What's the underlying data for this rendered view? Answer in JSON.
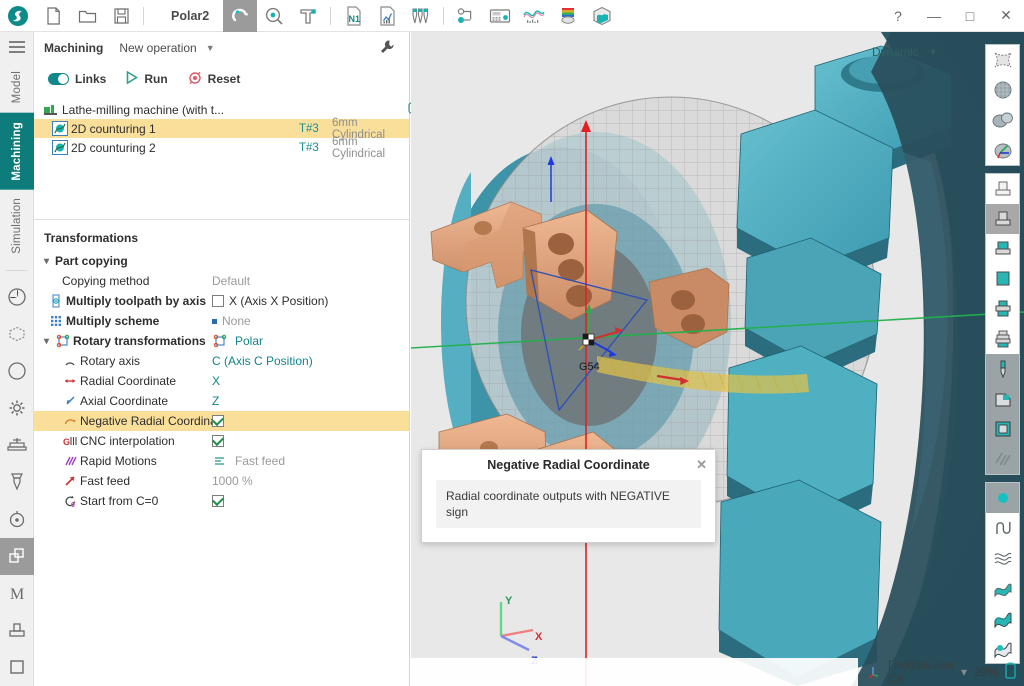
{
  "titlebar": {
    "document_title": "Polar2",
    "file_icons": [
      {
        "name": "new-file-icon",
        "label": "New"
      },
      {
        "name": "open-folder-icon",
        "label": "Open"
      },
      {
        "name": "save-icon",
        "label": "Save"
      }
    ],
    "mode_icons": [
      {
        "name": "machining-mode-icon",
        "label": "Machining",
        "active": true
      },
      {
        "name": "simulation-verify-icon",
        "label": "Verification"
      },
      {
        "name": "tool-setup-icon",
        "label": "Tool setup"
      },
      {
        "name": "nc-program-icon",
        "label": "N1"
      },
      {
        "name": "report-chart-icon",
        "label": "Report"
      },
      {
        "name": "tool-list-icon",
        "label": "Tool list"
      },
      {
        "name": "machine-scheme-icon",
        "label": "Machine scheme"
      },
      {
        "name": "cnc-panel-icon",
        "label": "CNC panel"
      },
      {
        "name": "graph-icon",
        "label": "Graph"
      },
      {
        "name": "material-icon",
        "label": "Material"
      },
      {
        "name": "stock-model-icon",
        "label": "Stock model"
      }
    ],
    "window_buttons": [
      {
        "name": "help-button",
        "glyph": "?"
      },
      {
        "name": "minimize-button",
        "glyph": "—"
      },
      {
        "name": "maximize-button",
        "glyph": "□"
      },
      {
        "name": "close-button",
        "glyph": "✕"
      }
    ]
  },
  "left_rail": {
    "menu_label": "menu",
    "tabs": [
      {
        "label": "Model",
        "selected": false
      },
      {
        "label": "Machining",
        "selected": true
      },
      {
        "label": "Simulation",
        "selected": false
      }
    ],
    "icons": [
      {
        "name": "render-shading-icon",
        "selected": false
      },
      {
        "name": "stock-selection-icon",
        "selected": false
      },
      {
        "name": "compass-orientation-icon",
        "selected": false
      },
      {
        "name": "settings-gear-icon",
        "selected": false
      },
      {
        "name": "machine-table-icon",
        "selected": false
      },
      {
        "name": "tool-holder-icon",
        "selected": false
      },
      {
        "name": "spindle-gauge-icon",
        "selected": false
      },
      {
        "name": "transformations-icon",
        "selected": true
      },
      {
        "name": "macro-m-icon",
        "selected": false
      },
      {
        "name": "fixture-icon",
        "selected": false
      },
      {
        "name": "blank-square-icon",
        "selected": false
      }
    ]
  },
  "operation_panel": {
    "title": "Machining",
    "new_operation_label": "New operation",
    "actions": [
      {
        "name": "links-toggle",
        "label": "Links",
        "on": true
      },
      {
        "name": "run-button",
        "label": "Run"
      },
      {
        "name": "reset-button",
        "label": "Reset"
      }
    ],
    "settings_icon": "wrench-icon"
  },
  "tree": {
    "rows": [
      {
        "name": "machine-node",
        "icon": "machine-icon",
        "label": "Lathe-milling machine (with t...",
        "tool": "",
        "description": "",
        "selected": false,
        "has_dot": false,
        "dot_color": "",
        "state_icon": "rounded-square-icon"
      },
      {
        "name": "operation-2d-contouring-1",
        "icon": "contouring-op-icon",
        "label": "2D counturing 1",
        "tool": "T#3",
        "description": "6mm Cylindrical",
        "selected": true,
        "has_dot": true,
        "dot_color": "#c9a227",
        "state_icon": "rounded-square-icon"
      },
      {
        "name": "operation-2d-contouring-2",
        "icon": "contouring-op-icon",
        "label": "2D counturing 2",
        "tool": "T#3",
        "description": "6mm Cylindrical",
        "selected": false,
        "has_dot": true,
        "dot_color": "#3e7b7b",
        "state_icon": "document-lines-icon"
      }
    ]
  },
  "transformations": {
    "title": "Transformations",
    "rows": [
      {
        "name": "group-part-copying",
        "indent": "grp",
        "expander": "⌄",
        "icon": "",
        "label": "Part copying",
        "value": "",
        "value_type": "none",
        "selected": false,
        "bold": true
      },
      {
        "name": "prop-copying-method",
        "indent": "ind1",
        "expander": "",
        "icon": "",
        "label": "Copying method",
        "value": "Default",
        "value_type": "grey",
        "selected": false,
        "bold": false
      },
      {
        "name": "prop-multiply-toolpath-by-axis",
        "indent": "ind0",
        "expander": "",
        "icon": "multiply-axis-icon",
        "label": "Multiply toolpath by axis",
        "value": "X (Axis X Position)",
        "value_type": "checkbox-off-italic",
        "selected": false,
        "bold": true
      },
      {
        "name": "prop-multiply-scheme",
        "indent": "ind0",
        "expander": "",
        "icon": "multiply-scheme-icon",
        "label": "Multiply scheme",
        "value": "None",
        "value_type": "bluedot-grey",
        "selected": false,
        "bold": true
      },
      {
        "name": "group-rotary-transformations",
        "indent": "grp",
        "expander": "⌄",
        "icon": "rotary-transform-icon",
        "label": "Rotary transformations",
        "value": "Polar",
        "value_type": "icon-teal",
        "selected": false,
        "bold": true
      },
      {
        "name": "prop-rotary-axis",
        "indent": "ind1",
        "expander": "",
        "icon": "rotary-axis-icon",
        "label": "Rotary axis",
        "value": "C (Axis C Position)",
        "value_type": "teal",
        "selected": false,
        "bold": false
      },
      {
        "name": "prop-radial-coordinate",
        "indent": "ind1",
        "expander": "",
        "icon": "radial-arrow-icon",
        "label": "Radial Coordinate",
        "value": "X",
        "value_type": "teal",
        "selected": false,
        "bold": false
      },
      {
        "name": "prop-axial-coordinate",
        "indent": "ind1",
        "expander": "",
        "icon": "axial-arrow-icon",
        "label": "Axial Coordinate",
        "value": "Z",
        "value_type": "teal",
        "selected": false,
        "bold": false
      },
      {
        "name": "prop-negative-radial-coordinate",
        "indent": "ind1",
        "expander": "",
        "icon": "negative-radial-icon",
        "label": "Negative Radial Coordinate",
        "value": "",
        "value_type": "checkbox-on",
        "selected": true,
        "bold": false
      },
      {
        "name": "prop-cnc-interpolation",
        "indent": "ind1",
        "expander": "",
        "icon": "cnc-g-icon",
        "label": "CNC interpolation",
        "value": "",
        "value_type": "checkbox-on",
        "selected": false,
        "bold": false
      },
      {
        "name": "prop-rapid-motions",
        "indent": "ind1",
        "expander": "",
        "icon": "rapid-motions-icon",
        "label": "Rapid Motions",
        "value": "Fast feed",
        "value_type": "icon-grey",
        "selected": false,
        "bold": false
      },
      {
        "name": "prop-fast-feed",
        "indent": "ind1",
        "expander": "",
        "icon": "fast-feed-icon",
        "label": "Fast feed",
        "value": "1000 %",
        "value_type": "grey",
        "selected": false,
        "bold": false
      },
      {
        "name": "prop-start-from-c0",
        "indent": "ind1",
        "expander": "",
        "icon": "start-c0-icon",
        "label": "Start from C=0",
        "value": "",
        "value_type": "checkbox-on",
        "selected": false,
        "bold": false
      }
    ]
  },
  "viewport": {
    "view_mode_label": "Dynamic",
    "axis_triad": {
      "x": "X",
      "y": "Y",
      "z": "Z"
    },
    "wcs_marker": "G54",
    "colors": {
      "background": "#e8e8e8",
      "stock_teal": "#3f9fb4",
      "stock_teal_dark": "#1f6b7c",
      "part_copper": "#e0a985",
      "part_copper_dark": "#b97f5c",
      "grid_disc": "#9a9a9a",
      "toolpath_yellow": "#e0c24a",
      "axis_red": "#e02020",
      "axis_green": "#22b14c",
      "axis_blue": "#2038e0"
    }
  },
  "tooltip": {
    "title": "Negative Radial Coordinate",
    "body": "Radial coordinate outputs with NEGATIVE sign",
    "close_glyph": "✕"
  },
  "right_toolbar": {
    "groups": [
      {
        "name": "display-group",
        "buttons": [
          {
            "name": "wireframe-view-icon",
            "selected": false
          },
          {
            "name": "mesh-sphere-icon",
            "selected": false
          },
          {
            "name": "shaded-solid-icon",
            "selected": false
          },
          {
            "name": "axes-shaded-icon",
            "selected": false
          }
        ]
      },
      {
        "name": "stock-stages-group",
        "buttons": [
          {
            "name": "stock-stage-1-icon",
            "selected": false
          },
          {
            "name": "stock-stage-2-icon",
            "selected": true
          },
          {
            "name": "stock-stage-3-icon",
            "selected": false
          },
          {
            "name": "stock-stage-4-icon",
            "selected": false
          },
          {
            "name": "stock-stage-5-icon",
            "selected": false
          },
          {
            "name": "stock-stage-6-icon",
            "selected": false
          },
          {
            "name": "tool-view-icon",
            "selected": false
          },
          {
            "name": "fixture-view-icon",
            "selected": false
          },
          {
            "name": "machine-view-icon",
            "selected": false
          },
          {
            "name": "hatch-view-icon",
            "selected": false
          }
        ]
      },
      {
        "name": "toolpath-display-group",
        "buttons": [
          {
            "name": "point-display-icon",
            "selected": false
          },
          {
            "name": "curve-display-icon",
            "selected": false
          },
          {
            "name": "surface-wire-icon",
            "selected": false
          },
          {
            "name": "surface-filled-icon",
            "selected": false
          },
          {
            "name": "surface-solid-icon",
            "selected": false
          },
          {
            "name": "surface-highlight-icon",
            "selected": true
          }
        ]
      }
    ]
  },
  "status_bar": {
    "coordinate_system": "Глобальная СК",
    "coordinate_system_caret": "▾",
    "zoom_level": "20%",
    "battery_icon": "battery-icon"
  }
}
